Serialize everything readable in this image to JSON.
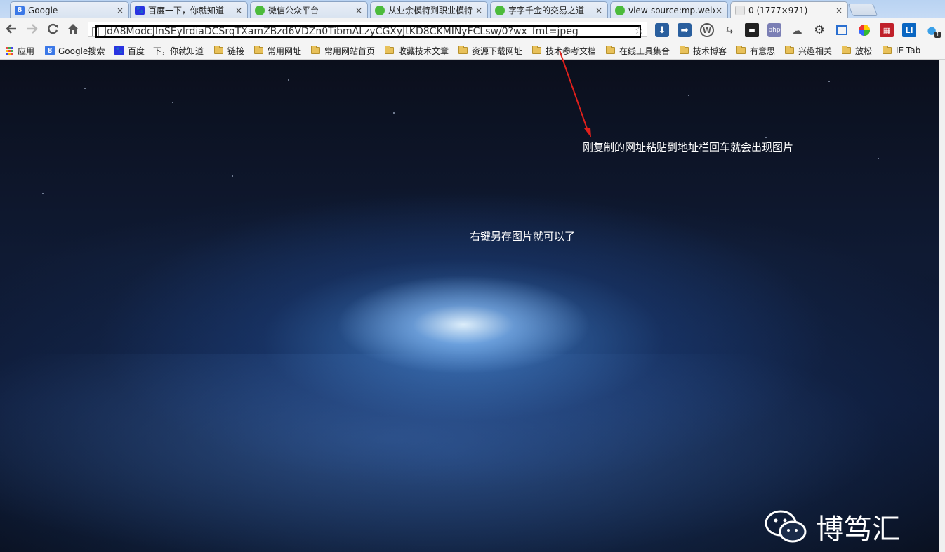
{
  "tabs": [
    {
      "title": "Google",
      "active": false,
      "favicon": "google-icon",
      "color": "#3b78e7"
    },
    {
      "title": "百度一下，你就知道",
      "active": false,
      "favicon": "baidu-paw-icon",
      "color": "#2932e1"
    },
    {
      "title": "微信公众平台",
      "active": false,
      "favicon": "wechat-icon",
      "color": "#4cbb3b"
    },
    {
      "title": "从业余模特到职业模特",
      "active": false,
      "favicon": "wechat-icon",
      "color": "#4cbb3b"
    },
    {
      "title": "字字千金的交易之道",
      "active": false,
      "favicon": "wechat-icon",
      "color": "#4cbb3b"
    },
    {
      "title": "view-source:mp.weix",
      "active": false,
      "favicon": "wechat-icon",
      "color": "#4cbb3b"
    },
    {
      "title": "0 (1777×971)",
      "active": true,
      "favicon": "image-icon",
      "color": "#bbbbbb"
    }
  ],
  "tab_close_symbol": "×",
  "toolbar": {
    "url": "JdA8ModcJInSEyIrdiaDCSrqTXamZBzd6VDZn0TibmALzyCGXyJtKD8CKMINyFCLsw/0?wx_fmt=jpeg",
    "back_icon": "back-arrow-icon",
    "forward_icon": "forward-arrow-icon",
    "reload_icon": "reload-icon",
    "home_icon": "home-icon",
    "extensions": [
      "download-icon",
      "share-icon",
      "wordpress-icon",
      "translate-icon",
      "terminal-icon",
      "php-icon",
      "cloud-icon",
      "gear-icon",
      "screenshot-icon",
      "color-wheel-icon",
      "red-grid-icon",
      "linkedin-icon",
      "qq-penguin-icon"
    ],
    "php_label": "php",
    "li_label": "LI",
    "badge": "1"
  },
  "bookmarks": [
    {
      "label": "应用",
      "icon": "apps-grid-icon"
    },
    {
      "label": "Google搜索",
      "icon": "google-icon"
    },
    {
      "label": "百度一下，你就知道",
      "icon": "baidu-paw-icon"
    },
    {
      "label": "链接",
      "icon": "folder-icon"
    },
    {
      "label": "常用网址",
      "icon": "folder-icon"
    },
    {
      "label": "常用网站首页",
      "icon": "folder-icon"
    },
    {
      "label": "收藏技术文章",
      "icon": "folder-icon"
    },
    {
      "label": "资源下载网址",
      "icon": "folder-icon"
    },
    {
      "label": "技术参考文档",
      "icon": "folder-icon"
    },
    {
      "label": "在线工具集合",
      "icon": "folder-icon"
    },
    {
      "label": "技术博客",
      "icon": "folder-icon"
    },
    {
      "label": "有意思",
      "icon": "folder-icon"
    },
    {
      "label": "兴趣相关",
      "icon": "folder-icon"
    },
    {
      "label": "放松",
      "icon": "folder-icon"
    },
    {
      "label": "IE Tab",
      "icon": "folder-icon"
    }
  ],
  "content": {
    "annotation": "刚复制的网址粘贴到地址栏回车就会出现图片",
    "center_text": "右键另存图片就可以了",
    "watermark": "博笃汇",
    "arrow_color": "#e0201c"
  }
}
